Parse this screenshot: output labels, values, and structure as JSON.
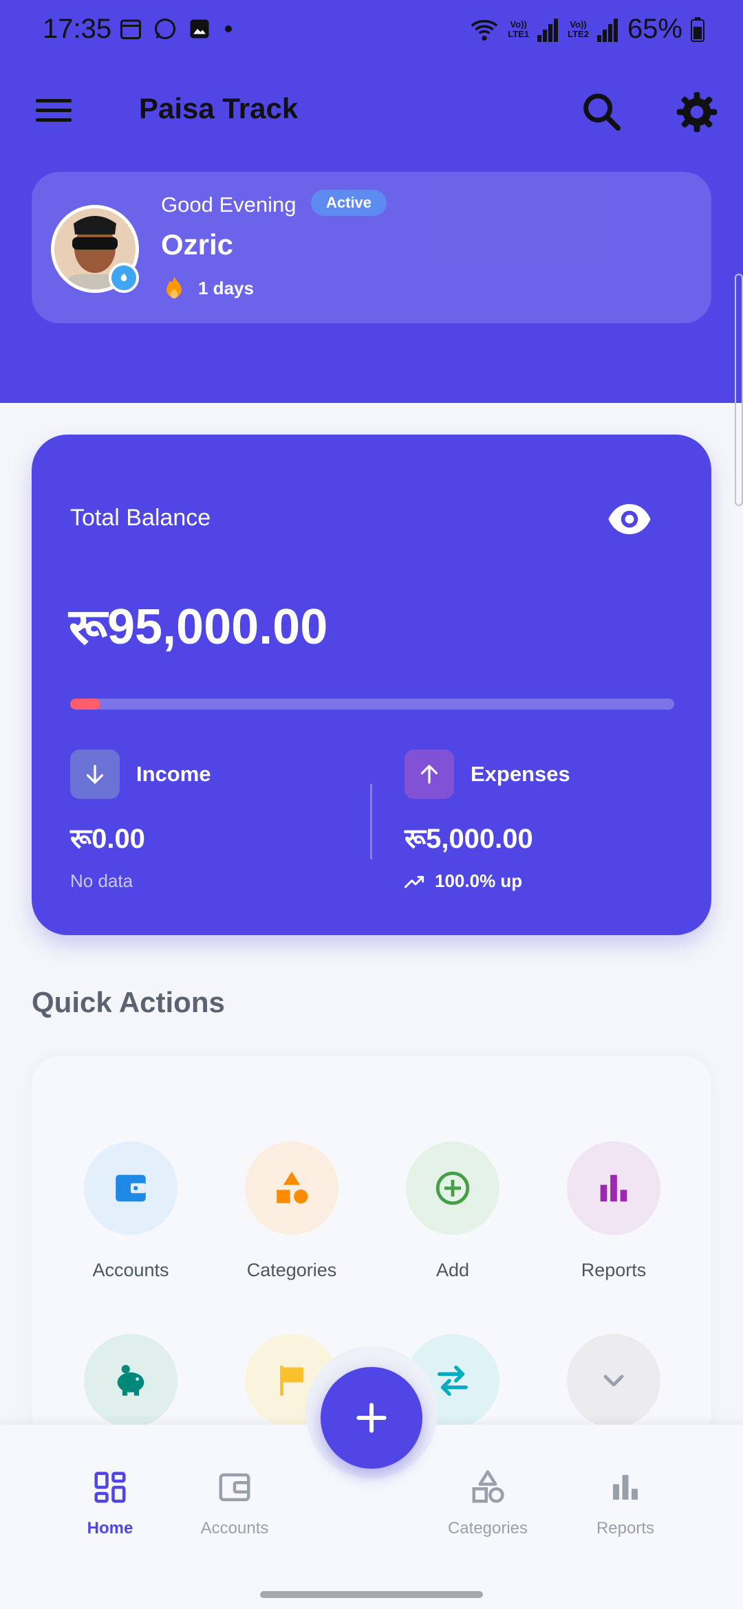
{
  "status_bar": {
    "time": "17:35",
    "battery": "65%",
    "sim1": "LTE1",
    "sim2": "LTE2",
    "volte": "Vo))",
    "notif_icons": [
      "calendar-icon",
      "whatsapp-icon",
      "gallery-icon",
      "dot-icon"
    ]
  },
  "app": {
    "title": "Paisa Track"
  },
  "profile": {
    "greeting": "Good Evening",
    "status_badge": "Active",
    "name": "Ozric",
    "streak": "1 days"
  },
  "balance": {
    "label": "Total Balance",
    "amount": "रू95,000.00",
    "spent_fraction": 0.05,
    "income": {
      "label": "Income",
      "value": "रू0.00",
      "sub": "No data"
    },
    "expenses": {
      "label": "Expenses",
      "value": "रू5,000.00",
      "sub": "100.0% up"
    }
  },
  "quick_actions": {
    "title": "Quick Actions",
    "items": [
      {
        "label": "Accounts",
        "icon": "wallet-icon",
        "color": "#1e88e5",
        "bg": "#e3f0fb"
      },
      {
        "label": "Categories",
        "icon": "shapes-icon",
        "color": "#fb8c00",
        "bg": "#fbeee0"
      },
      {
        "label": "Add",
        "icon": "add-circle-icon",
        "color": "#43a047",
        "bg": "#e5f2e7"
      },
      {
        "label": "Reports",
        "icon": "bar-chart-icon",
        "color": "#9c27b0",
        "bg": "#f1e4f3"
      },
      {
        "label": "",
        "icon": "piggy-bank-icon",
        "color": "#00897b",
        "bg": "#dff0ec"
      },
      {
        "label": "",
        "icon": "flag-icon",
        "color": "#fbc02d",
        "bg": "#fbf4dd"
      },
      {
        "label": "",
        "icon": "swap-icon",
        "color": "#00acc1",
        "bg": "#dff3f6"
      },
      {
        "label": "",
        "icon": "chevron-down-icon",
        "color": "#9aa0ab",
        "bg": "#ececef"
      }
    ]
  },
  "bottom_nav": {
    "items": [
      {
        "label": "Home"
      },
      {
        "label": "Accounts"
      },
      {
        "label": "Categories"
      },
      {
        "label": "Reports"
      }
    ]
  },
  "colors": {
    "primary": "#4f46e5",
    "progress": "#ff5c6c",
    "streak": "#ff9800",
    "income_icon_bg": "#6b73d6",
    "expense_icon_bg": "#8152d6"
  }
}
